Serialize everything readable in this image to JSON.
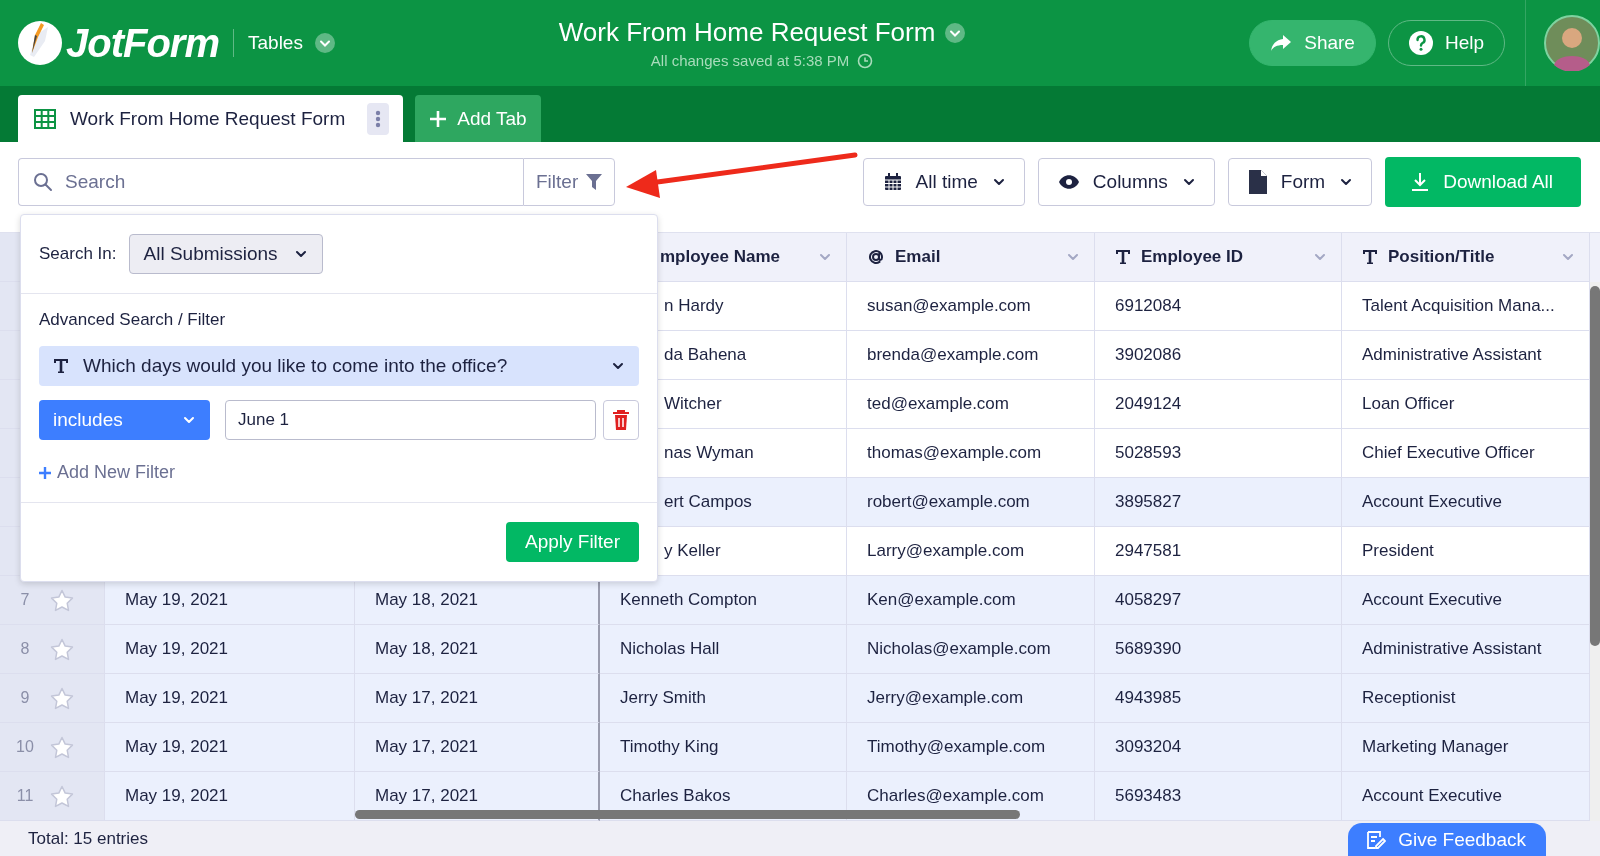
{
  "header": {
    "logo": "JotForm",
    "app_menu": "Tables",
    "title": "Work From Home Request Form",
    "save_status": "All changes saved at 5:38 PM",
    "buttons": [
      {
        "label": "Share",
        "kind": "filled"
      },
      {
        "label": "Help",
        "kind": "outlined"
      }
    ]
  },
  "tabs": [
    {
      "label": "Work From Home Request Form",
      "selected": true
    }
  ],
  "add_tab": "Add Tab",
  "toolbar": {
    "search": {
      "placeholder": "Search"
    },
    "filter_button": "Filter",
    "dropdowns": [
      "All time",
      "Columns",
      "Form"
    ],
    "download_button": "Download All"
  },
  "filter_panel": {
    "search_in_label": "Search In:",
    "search_in_value": "All Submissions",
    "section_title": "Advanced Search / Filter",
    "filters": [
      {
        "field": "Which days would you like to come into the office?",
        "operator": "includes",
        "value": "June 1"
      }
    ],
    "add_filter": "Add New Filter",
    "apply_button": "Apply Filter"
  },
  "table": {
    "columns": [
      {
        "label": "mployee Name",
        "kind": "name"
      },
      {
        "label": "Email",
        "kind": "email"
      },
      {
        "label": "Employee ID",
        "kind": "text"
      },
      {
        "label": "Position/Title",
        "kind": "text"
      }
    ],
    "rows": [
      {
        "name": "n Hardy",
        "email": "susan@example.com",
        "employee_id": "6912084",
        "position": "Talent Acquisition Mana...",
        "shaded": false
      },
      {
        "name": "da Bahena",
        "email": "brenda@example.com",
        "employee_id": "3902086",
        "position": "Administrative Assistant",
        "shaded": false
      },
      {
        "name": "Witcher",
        "email": "ted@example.com",
        "employee_id": "2049124",
        "position": "Loan Officer",
        "shaded": false
      },
      {
        "name": "nas Wyman",
        "email": "thomas@example.com",
        "employee_id": "5028593",
        "position": "Chief Executive Officer",
        "shaded": false
      },
      {
        "name": "ert Campos",
        "email": "robert@example.com",
        "employee_id": "3895827",
        "position": "Account Executive",
        "shaded": true
      },
      {
        "name": "y Keller",
        "email": "Larry@example.com",
        "employee_id": "2947581",
        "position": "President",
        "shaded": false
      },
      {
        "number": "7",
        "starred": false,
        "submitted": "May 19, 2021",
        "date": "May 18, 2021",
        "name": "Kenneth Compton",
        "email": "Ken@example.com",
        "employee_id": "4058297",
        "position": "Account Executive",
        "shaded": true
      },
      {
        "number": "8",
        "starred": false,
        "submitted": "May 19, 2021",
        "date": "May 18, 2021",
        "name": "Nicholas Hall",
        "email": "Nicholas@example.com",
        "employee_id": "5689390",
        "position": "Administrative Assistant",
        "shaded": true
      },
      {
        "number": "9",
        "starred": false,
        "submitted": "May 19, 2021",
        "date": "May 17, 2021",
        "name": "Jerry Smith",
        "email": "Jerry@example.com",
        "employee_id": "4943985",
        "position": "Receptionist",
        "shaded": true
      },
      {
        "number": "10",
        "starred": false,
        "submitted": "May 19, 2021",
        "date": "May 17, 2021",
        "name": "Timothy King",
        "email": "Timothy@example.com",
        "employee_id": "3093204",
        "position": "Marketing Manager",
        "shaded": true
      },
      {
        "number": "11",
        "starred": false,
        "submitted": "May 19, 2021",
        "date": "May 17, 2021",
        "name": "Charles Bakos",
        "email": "Charles@example.com",
        "employee_id": "5693483",
        "position": "Account Executive",
        "shaded": true
      }
    ]
  },
  "footer": {
    "total": "Total: 15 entries",
    "feedback_button": "Give Feedback"
  }
}
